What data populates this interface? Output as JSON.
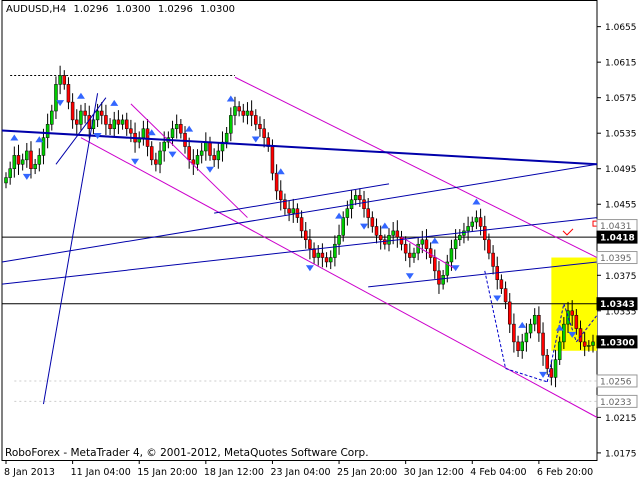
{
  "header": {
    "symbol_tf": "AUDUSD,H4",
    "ohlc": [
      "1.0296",
      "1.0300",
      "1.0296",
      "1.0300"
    ]
  },
  "footer": "RoboForex - MetaTrader 4, © 2001-2012, MetaQuotes Software Corp.",
  "colors": {
    "bull": "#00cc00",
    "bear": "#ff0000",
    "channel": "#cc00cc",
    "trend": "#0000aa",
    "arrow": "#3366ff",
    "box": "#ffff00"
  },
  "chart_data": {
    "type": "candlestick",
    "title": "AUDUSD,H4",
    "ylim": [
      1.0167,
      1.0685
    ],
    "y_ticks": [
      "1.0655",
      "1.0615",
      "1.0575",
      "1.0535",
      "1.0495",
      "1.0455",
      "1.0375",
      "1.0335",
      "1.0215",
      "1.0175"
    ],
    "price_labels": [
      {
        "text": "1.0431",
        "value": 1.0431,
        "style": "light"
      },
      {
        "text": "1.0418",
        "value": 1.0418,
        "style": "dark"
      },
      {
        "text": "1.0395",
        "value": 1.0395,
        "style": "light"
      },
      {
        "text": "1.0343",
        "value": 1.0343,
        "style": "dark"
      },
      {
        "text": "1.0300",
        "value": 1.03,
        "style": "dark"
      },
      {
        "text": "1.0256",
        "value": 1.0256,
        "style": "light"
      },
      {
        "text": "1.0233",
        "value": 1.0233,
        "style": "light"
      }
    ],
    "x_ticks": [
      "8 Jan 2013",
      "11 Jan 04:00",
      "15 Jan 20:00",
      "18 Jan 12:00",
      "23 Jan 04:00",
      "25 Jan 20:00",
      "30 Jan 12:00",
      "4 Feb 04:00",
      "6 Feb 20:00"
    ],
    "x_tick_index": [
      0,
      16,
      32,
      48,
      64,
      80,
      96,
      112,
      128
    ],
    "num_bars": 142,
    "h_levels": [
      1.0418,
      1.0343
    ],
    "dotted_levels": [
      1.06
    ],
    "close": [
      1.0485,
      1.0495,
      1.051,
      1.05,
      1.0505,
      1.0515,
      1.0495,
      1.05,
      1.051,
      1.053,
      1.0545,
      1.056,
      1.059,
      1.06,
      1.059,
      1.057,
      1.055,
      1.0545,
      1.056,
      1.0555,
      1.054,
      1.055,
      1.056,
      1.0555,
      1.0545,
      1.054,
      1.055,
      1.0545,
      1.055,
      1.054,
      1.0535,
      1.0525,
      1.053,
      1.054,
      1.052,
      1.0505,
      1.05,
      1.0515,
      1.0525,
      1.053,
      1.054,
      1.0545,
      1.0535,
      1.052,
      1.0505,
      1.05,
      1.051,
      1.0515,
      1.0525,
      1.051,
      1.0505,
      1.0515,
      1.0525,
      1.0535,
      1.0555,
      1.0565,
      1.056,
      1.0555,
      1.056,
      1.0555,
      1.0545,
      1.054,
      1.053,
      1.052,
      1.049,
      1.047,
      1.046,
      1.045,
      1.0445,
      1.045,
      1.044,
      1.0425,
      1.0415,
      1.0405,
      1.0395,
      1.04,
      1.0395,
      1.039,
      1.0395,
      1.041,
      1.042,
      1.044,
      1.045,
      1.046,
      1.0465,
      1.046,
      1.045,
      1.044,
      1.043,
      1.042,
      1.0415,
      1.041,
      1.042,
      1.0425,
      1.0418,
      1.041,
      1.04,
      1.0395,
      1.04,
      1.041,
      1.0415,
      1.0405,
      1.0395,
      1.038,
      1.0365,
      1.0375,
      1.039,
      1.0405,
      1.0415,
      1.042,
      1.0425,
      1.043,
      1.0435,
      1.044,
      1.043,
      1.0415,
      1.04,
      1.0385,
      1.037,
      1.036,
      1.0345,
      1.032,
      1.03,
      1.029,
      1.03,
      1.031,
      1.032,
      1.033,
      1.031,
      1.0285,
      1.027,
      1.026,
      1.028,
      1.03,
      1.032,
      1.0335,
      1.033,
      1.0315,
      1.03,
      1.0295,
      1.0296,
      1.03
    ]
  }
}
